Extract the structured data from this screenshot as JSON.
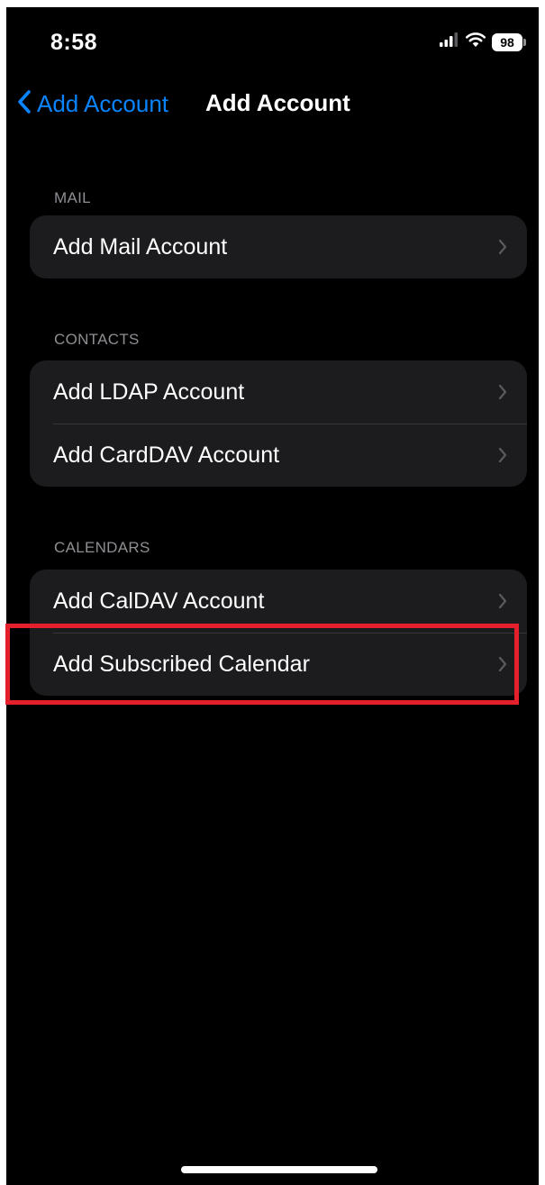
{
  "status_bar": {
    "time": "8:58",
    "battery": "98"
  },
  "nav": {
    "back_label": "Add Account",
    "title": "Add Account"
  },
  "sections": {
    "mail": {
      "header": "MAIL",
      "items": [
        "Add Mail Account"
      ]
    },
    "contacts": {
      "header": "CONTACTS",
      "items": [
        "Add LDAP Account",
        "Add CardDAV Account"
      ]
    },
    "calendars": {
      "header": "CALENDARS",
      "items": [
        "Add CalDAV Account",
        "Add Subscribed Calendar"
      ]
    }
  },
  "annotation": {
    "highlighted_item": "Add Subscribed Calendar",
    "color": "#e3202c"
  },
  "colors": {
    "accent": "#0a84ff",
    "background": "#000000",
    "cell_background": "#1c1c1e",
    "section_header": "#8e8e93"
  },
  "icons": {
    "back": "chevron-left-icon",
    "row": "chevron-right-icon",
    "signal": "cellular-signal-icon",
    "wifi": "wifi-icon",
    "battery": "battery-icon"
  }
}
